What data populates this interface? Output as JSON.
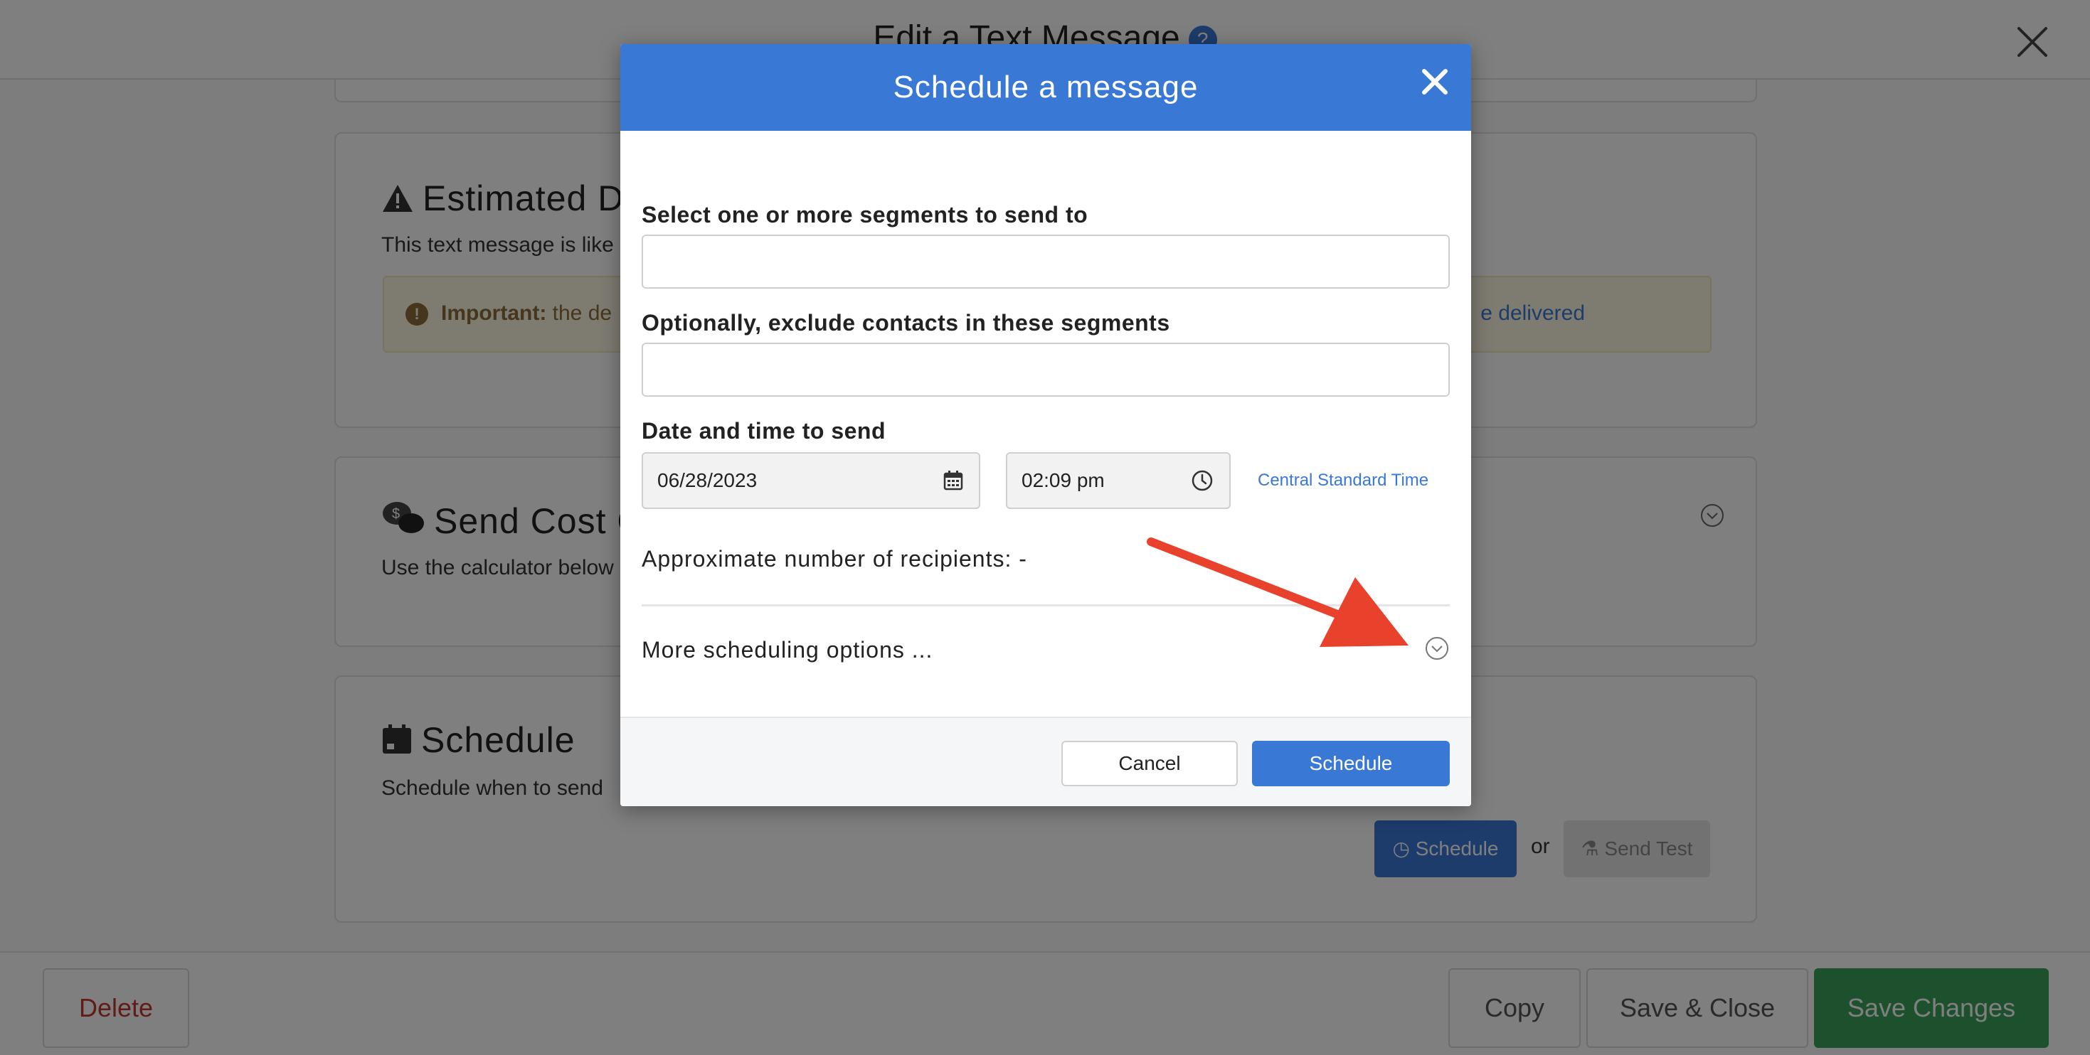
{
  "page": {
    "title": "Edit a Text Message",
    "help_badge": "?",
    "cards": {
      "estimated": {
        "title": "Estimated D",
        "description": "This text message is like",
        "important_label": "Important:",
        "important_text": " the de",
        "important_link": "e delivered"
      },
      "send_cost": {
        "title": "Send Cost C",
        "description": "Use the calculator below"
      },
      "schedule": {
        "title": "Schedule",
        "description": "Schedule when to send",
        "schedule_button": "Schedule",
        "or_text": "or",
        "send_test_button": "Send Test"
      }
    },
    "footer": {
      "delete": "Delete",
      "copy": "Copy",
      "save_close": "Save & Close",
      "save_changes": "Save Changes"
    }
  },
  "modal": {
    "title": "Schedule a message",
    "segments_label": "Select one or more segments to send to",
    "segments_value": "",
    "exclude_label": "Optionally, exclude contacts in these segments",
    "exclude_value": "",
    "datetime_label": "Date and time to send",
    "date_value": "06/28/2023",
    "time_value": "02:09 pm",
    "timezone": "Central Standard Time",
    "recipients_text": "Approximate number of recipients: -",
    "more_options": "More scheduling options ...",
    "cancel": "Cancel",
    "schedule": "Schedule"
  },
  "colors": {
    "primary": "#3a78d6",
    "success": "#3aa35a",
    "danger": "#c0392b",
    "annotation_arrow": "#e8412c"
  }
}
